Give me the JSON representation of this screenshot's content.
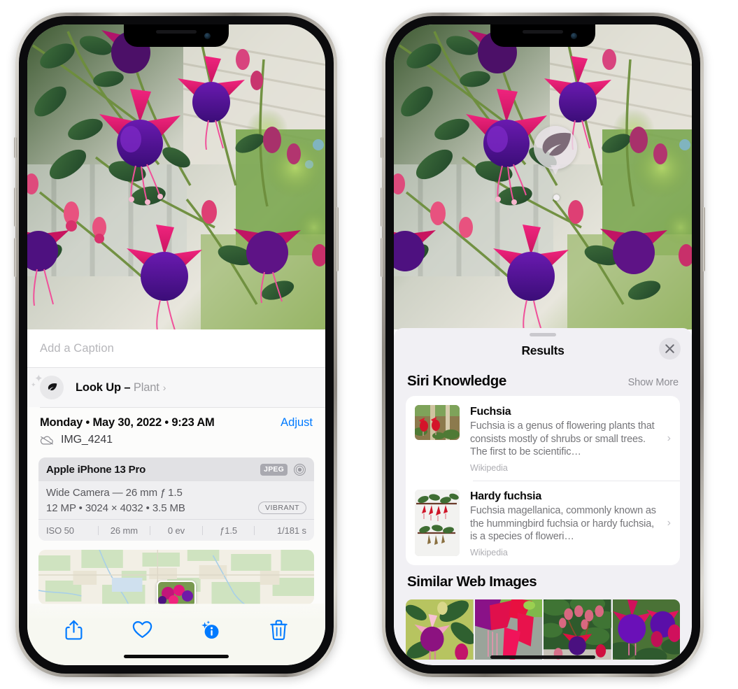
{
  "left_phone": {
    "photo": {
      "alt_name": "fuchsia-flowers-photo"
    },
    "caption_placeholder": "Add a Caption",
    "lookup": {
      "label": "Look Up –",
      "subject": "Plant",
      "chevron": "›",
      "icon": "leaf-icon",
      "sparkle": "✦",
      "sparkle_small": "✦"
    },
    "date": "Monday • May 30, 2022 • 9:23 AM",
    "adjust_label": "Adjust",
    "filename": "IMG_4241",
    "cloud_icon": "icloud-slash-icon",
    "exif": {
      "device": "Apple iPhone 13 Pro",
      "format_tag": "JPEG",
      "raw_icon": "aperture-icon",
      "lens_line": "Wide Camera — 26 mm ƒ 1.5",
      "size_line": "12 MP • 3024 × 4032 • 3.5 MB",
      "style_tag": "VIBRANT",
      "stats": [
        "ISO 50",
        "26 mm",
        "0 ev",
        "ƒ1.5",
        "1/181 s"
      ]
    },
    "toolbar": [
      {
        "name": "share-button",
        "icon": "share-icon"
      },
      {
        "name": "favorite-button",
        "icon": "heart-icon"
      },
      {
        "name": "info-button",
        "icon": "info-sparkle-icon"
      },
      {
        "name": "delete-button",
        "icon": "trash-icon"
      }
    ],
    "accent_color": "#007aff"
  },
  "right_phone": {
    "photo": {
      "alt_name": "fuchsia-flowers-photo"
    },
    "detection_badge": {
      "icon": "leaf-icon",
      "name": "visual-lookup-leaf-badge"
    },
    "sheet": {
      "title": "Results",
      "close_icon": "close-icon",
      "sections": [
        {
          "title": "Siri Knowledge",
          "action": "Show More",
          "items": [
            {
              "title": "Fuchsia",
              "description": "Fuchsia is a genus of flowering plants that consists mostly of shrubs or small trees. The first to be scientific…",
              "source": "Wikipedia",
              "thumb": "fuchsia-red-flowers-thumb",
              "chevron": "›"
            },
            {
              "title": "Hardy fuchsia",
              "description": "Fuchsia magellanica, commonly known as the hummingbird fuchsia or hardy fuchsia, is a species of floweri…",
              "source": "Wikipedia",
              "thumb": "hardy-fuchsia-branch-thumb",
              "chevron": "›"
            }
          ]
        },
        {
          "title": "Similar Web Images",
          "images": [
            "fuchsia-pink-purple-leaf-thumb",
            "fuchsia-red-closeup-thumb",
            "fuchsia-bush-buds-thumb",
            "fuchsia-purple-hanging-thumb"
          ]
        }
      ]
    }
  }
}
